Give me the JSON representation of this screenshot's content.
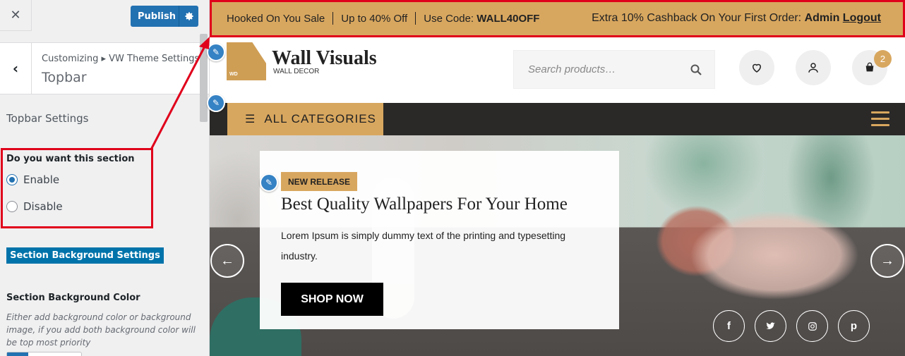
{
  "sidebar": {
    "close_glyph": "✕",
    "publish_label": "Publish",
    "back_glyph": "‹",
    "breadcrumb": "Customizing ▸ VW Theme Settings",
    "panel_title": "Topbar",
    "section_heading": "Topbar Settings",
    "section_question": "Do you want this section",
    "radio_options": [
      "Enable",
      "Disable"
    ],
    "radio_selected": "Enable",
    "bg_settings_button": "Section Background Settings",
    "bg_color_label": "Section Background Color",
    "bg_color_description": "Either add background color or background image, if you add both background color will be top most priority"
  },
  "topbar": {
    "items": [
      "Hooked On You Sale",
      "Up to 40% Off"
    ],
    "code_prefix": "Use Code: ",
    "code": "WALL40OFF",
    "cashback_text": "Extra 10% Cashback On Your First Order:",
    "admin_label": "Admin",
    "logout_label": "Logout",
    "bg_color": "#d8a75f"
  },
  "header": {
    "logo_mark_text": "WD",
    "logo_name": "Wall Visuals",
    "logo_sub": "WALL DECOR",
    "search_placeholder": "Search products…",
    "cart_count": "2"
  },
  "nav": {
    "all_categories": "ALL CATEGORIES"
  },
  "hero": {
    "badge": "NEW RELEASE",
    "title": "Best Quality Wallpapers For Your Home",
    "description": "Lorem Ipsum is simply dummy text of the printing and typesetting industry.",
    "cta": "SHOP NOW",
    "social": [
      "f",
      "t",
      "ig",
      "p"
    ]
  },
  "colors": {
    "accent": "#d8a75f",
    "annotation": "#e0001b",
    "wp_blue": "#2271b1"
  }
}
